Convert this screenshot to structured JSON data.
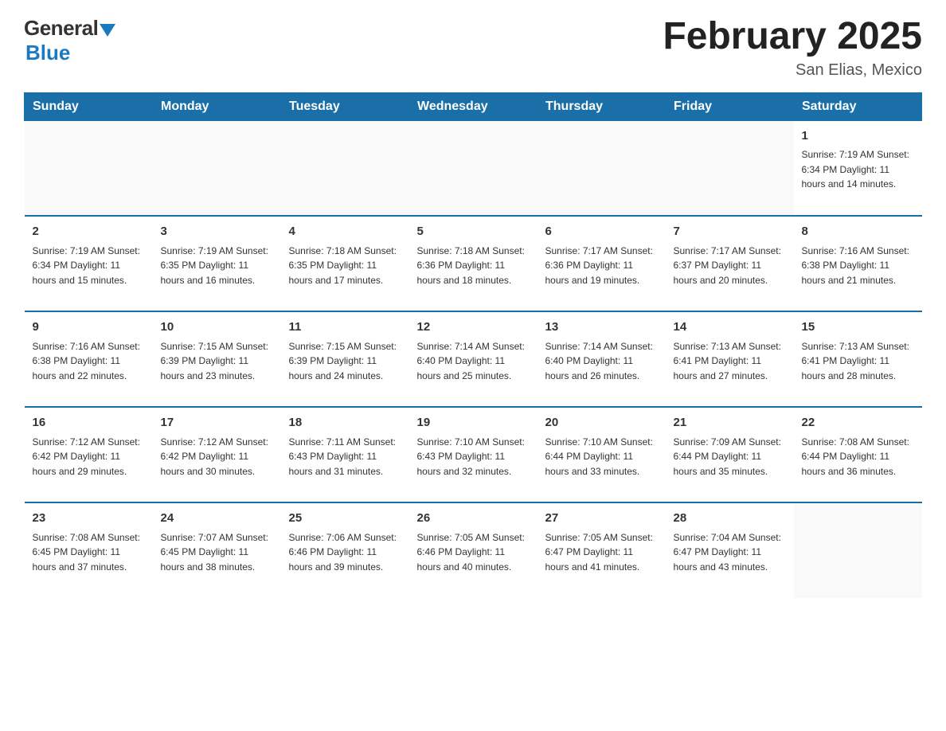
{
  "logo": {
    "general": "General",
    "blue": "Blue",
    "subtitle": "Blue"
  },
  "header": {
    "title": "February 2025",
    "location": "San Elias, Mexico"
  },
  "days_of_week": [
    "Sunday",
    "Monday",
    "Tuesday",
    "Wednesday",
    "Thursday",
    "Friday",
    "Saturday"
  ],
  "weeks": [
    [
      {
        "day": "",
        "info": ""
      },
      {
        "day": "",
        "info": ""
      },
      {
        "day": "",
        "info": ""
      },
      {
        "day": "",
        "info": ""
      },
      {
        "day": "",
        "info": ""
      },
      {
        "day": "",
        "info": ""
      },
      {
        "day": "1",
        "info": "Sunrise: 7:19 AM\nSunset: 6:34 PM\nDaylight: 11 hours and 14 minutes."
      }
    ],
    [
      {
        "day": "2",
        "info": "Sunrise: 7:19 AM\nSunset: 6:34 PM\nDaylight: 11 hours and 15 minutes."
      },
      {
        "day": "3",
        "info": "Sunrise: 7:19 AM\nSunset: 6:35 PM\nDaylight: 11 hours and 16 minutes."
      },
      {
        "day": "4",
        "info": "Sunrise: 7:18 AM\nSunset: 6:35 PM\nDaylight: 11 hours and 17 minutes."
      },
      {
        "day": "5",
        "info": "Sunrise: 7:18 AM\nSunset: 6:36 PM\nDaylight: 11 hours and 18 minutes."
      },
      {
        "day": "6",
        "info": "Sunrise: 7:17 AM\nSunset: 6:36 PM\nDaylight: 11 hours and 19 minutes."
      },
      {
        "day": "7",
        "info": "Sunrise: 7:17 AM\nSunset: 6:37 PM\nDaylight: 11 hours and 20 minutes."
      },
      {
        "day": "8",
        "info": "Sunrise: 7:16 AM\nSunset: 6:38 PM\nDaylight: 11 hours and 21 minutes."
      }
    ],
    [
      {
        "day": "9",
        "info": "Sunrise: 7:16 AM\nSunset: 6:38 PM\nDaylight: 11 hours and 22 minutes."
      },
      {
        "day": "10",
        "info": "Sunrise: 7:15 AM\nSunset: 6:39 PM\nDaylight: 11 hours and 23 minutes."
      },
      {
        "day": "11",
        "info": "Sunrise: 7:15 AM\nSunset: 6:39 PM\nDaylight: 11 hours and 24 minutes."
      },
      {
        "day": "12",
        "info": "Sunrise: 7:14 AM\nSunset: 6:40 PM\nDaylight: 11 hours and 25 minutes."
      },
      {
        "day": "13",
        "info": "Sunrise: 7:14 AM\nSunset: 6:40 PM\nDaylight: 11 hours and 26 minutes."
      },
      {
        "day": "14",
        "info": "Sunrise: 7:13 AM\nSunset: 6:41 PM\nDaylight: 11 hours and 27 minutes."
      },
      {
        "day": "15",
        "info": "Sunrise: 7:13 AM\nSunset: 6:41 PM\nDaylight: 11 hours and 28 minutes."
      }
    ],
    [
      {
        "day": "16",
        "info": "Sunrise: 7:12 AM\nSunset: 6:42 PM\nDaylight: 11 hours and 29 minutes."
      },
      {
        "day": "17",
        "info": "Sunrise: 7:12 AM\nSunset: 6:42 PM\nDaylight: 11 hours and 30 minutes."
      },
      {
        "day": "18",
        "info": "Sunrise: 7:11 AM\nSunset: 6:43 PM\nDaylight: 11 hours and 31 minutes."
      },
      {
        "day": "19",
        "info": "Sunrise: 7:10 AM\nSunset: 6:43 PM\nDaylight: 11 hours and 32 minutes."
      },
      {
        "day": "20",
        "info": "Sunrise: 7:10 AM\nSunset: 6:44 PM\nDaylight: 11 hours and 33 minutes."
      },
      {
        "day": "21",
        "info": "Sunrise: 7:09 AM\nSunset: 6:44 PM\nDaylight: 11 hours and 35 minutes."
      },
      {
        "day": "22",
        "info": "Sunrise: 7:08 AM\nSunset: 6:44 PM\nDaylight: 11 hours and 36 minutes."
      }
    ],
    [
      {
        "day": "23",
        "info": "Sunrise: 7:08 AM\nSunset: 6:45 PM\nDaylight: 11 hours and 37 minutes."
      },
      {
        "day": "24",
        "info": "Sunrise: 7:07 AM\nSunset: 6:45 PM\nDaylight: 11 hours and 38 minutes."
      },
      {
        "day": "25",
        "info": "Sunrise: 7:06 AM\nSunset: 6:46 PM\nDaylight: 11 hours and 39 minutes."
      },
      {
        "day": "26",
        "info": "Sunrise: 7:05 AM\nSunset: 6:46 PM\nDaylight: 11 hours and 40 minutes."
      },
      {
        "day": "27",
        "info": "Sunrise: 7:05 AM\nSunset: 6:47 PM\nDaylight: 11 hours and 41 minutes."
      },
      {
        "day": "28",
        "info": "Sunrise: 7:04 AM\nSunset: 6:47 PM\nDaylight: 11 hours and 43 minutes."
      },
      {
        "day": "",
        "info": ""
      }
    ]
  ]
}
